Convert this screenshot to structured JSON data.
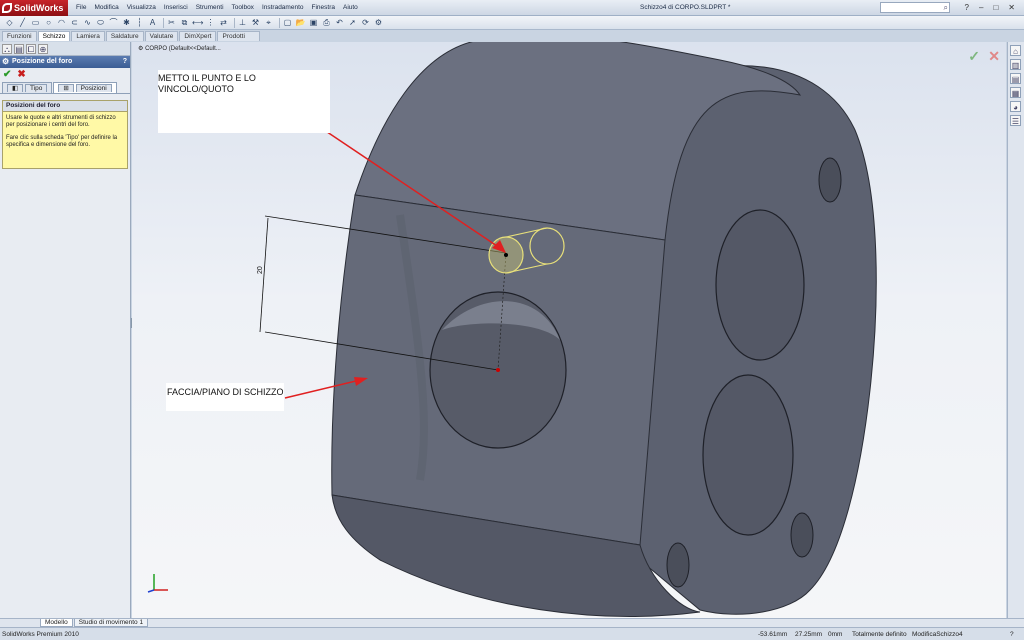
{
  "app": {
    "logo": "SolidWorks",
    "doc_title": "Schizzo4 di CORPO.SLDPRT *"
  },
  "menu": [
    "File",
    "Modifica",
    "Visualizza",
    "Inserisci",
    "Strumenti",
    "Toolbox",
    "Instradamento",
    "Finestra",
    "Aiuto"
  ],
  "command_tabs": [
    "Funzioni",
    "Schizzo",
    "Lamiera",
    "Saldature",
    "Valutare",
    "DimXpert",
    "Prodotti Office"
  ],
  "property_manager": {
    "title": "Posizione del foro",
    "help": "?",
    "tabs": [
      "Tipo",
      "Posizioni"
    ],
    "section_title": "Posizioni del foro",
    "message_1": "Usare le quote e altri strumenti di schizzo per posizionare i centri del foro.",
    "message_2": "Fare clic sulla scheda 'Tipo' per definire la specifica e dimensione del foro."
  },
  "viewport": {
    "tree_flyout": "CORPO  (Default<<Default...",
    "annotation_1": "METTO IL PUNTO E LO VINCOLO/QUOTO",
    "annotation_2": "FACCIA/PIANO DI SCHIZZO",
    "dimension_value": "20"
  },
  "bottom_tabs": [
    "Modello",
    "Studio di movimento 1"
  ],
  "status": {
    "product": "SolidWorks Premium 2010",
    "x": "-53.61mm",
    "y": "27.25mm",
    "z": "0mm",
    "state": "Totalmente definito",
    "mode": "ModificaSchizzo4",
    "help": "?"
  },
  "colors": {
    "annotation_red": "#e02020",
    "body_gray": "#5f6474",
    "selection_yellow": "#e8e07a"
  }
}
